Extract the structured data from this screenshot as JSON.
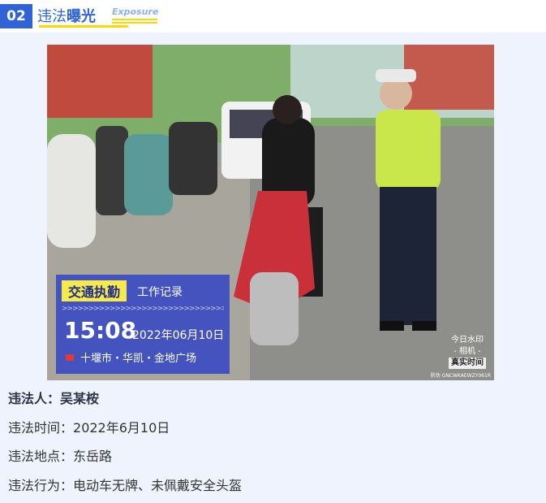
{
  "header": {
    "number": "02",
    "title_part1": "违法",
    "title_part2": "曝光",
    "subtitle_en": "Exposure"
  },
  "photo": {
    "overlay": {
      "category": "交通执勤",
      "type": "工作记录",
      "time": "15:08",
      "date": "2022年06月10日",
      "location": "十堰市・华凯・金地广场"
    },
    "camera_watermark": {
      "line1": "今日水印",
      "line2": "- 相机 -",
      "line3": "真实时间",
      "code": "防伪 GNCWKAEWZY061R"
    }
  },
  "details": {
    "violator_label": "违法人：",
    "violator_value": "吴某桉",
    "time_label": "违法时间：",
    "time_value": "2022年6月10日",
    "place_label": "违法地点：",
    "place_value": "东岳路",
    "behavior_label": "违法行为：",
    "behavior_value": "电动车无牌、未佩戴安全头盔"
  },
  "colors": {
    "accent": "#2f63d6",
    "underline": "#f5d90a",
    "panel_bg": "#eef3fd"
  }
}
